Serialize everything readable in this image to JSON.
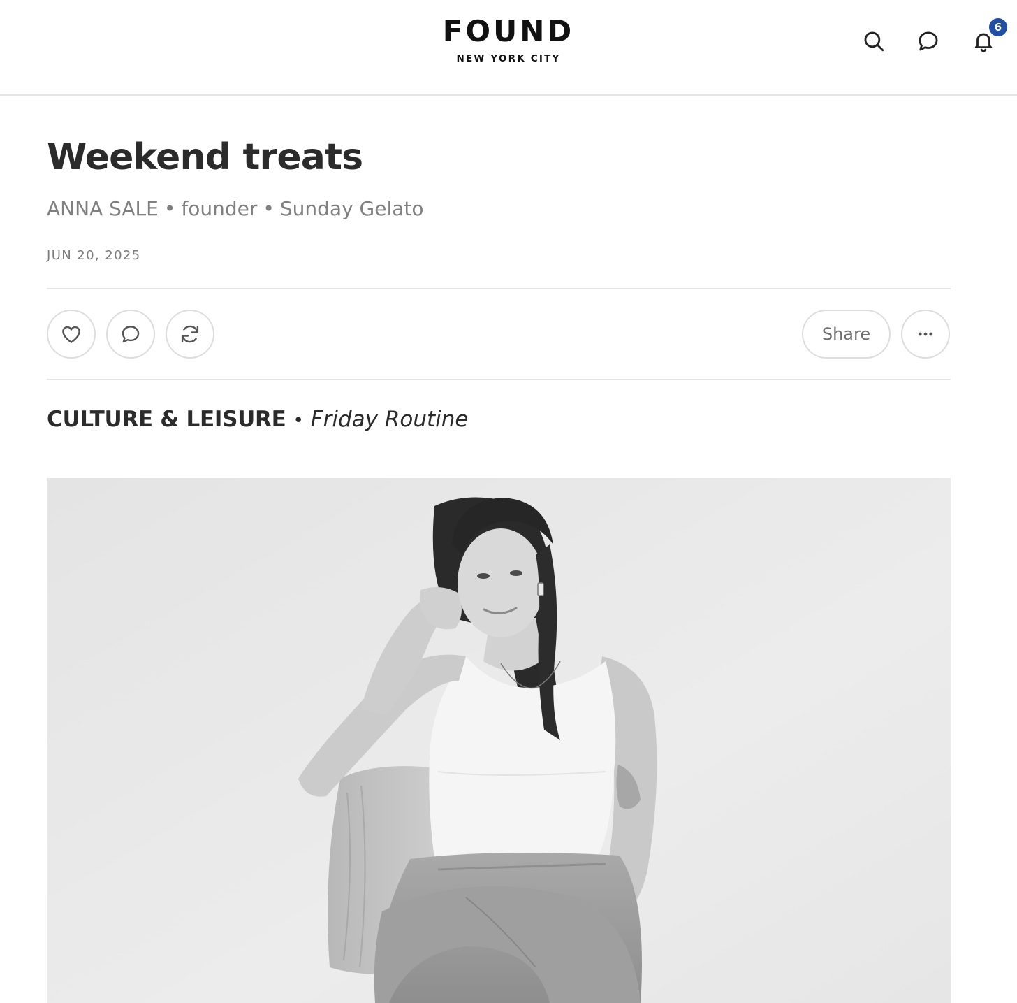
{
  "header": {
    "brand_name": "FOUND",
    "brand_sub": "NEW YORK CITY",
    "icons": [
      "search-icon",
      "chat-icon",
      "bell-icon"
    ],
    "notification_count": "6",
    "badge_color": "#1f4ea3"
  },
  "article": {
    "title": "Weekend treats",
    "author": "ANNA SALE",
    "role": "founder",
    "company": "Sunday Gelato",
    "separator": "•",
    "date": "JUN 20, 2025",
    "category": "CULTURE & LEISURE",
    "series": "Friday Routine"
  },
  "actions": {
    "icons": [
      "heart-icon",
      "comment-icon",
      "restack-icon",
      "more-icon"
    ],
    "share_label": "Share"
  },
  "hero_image": {
    "subject": "black-and-white portrait photo"
  }
}
